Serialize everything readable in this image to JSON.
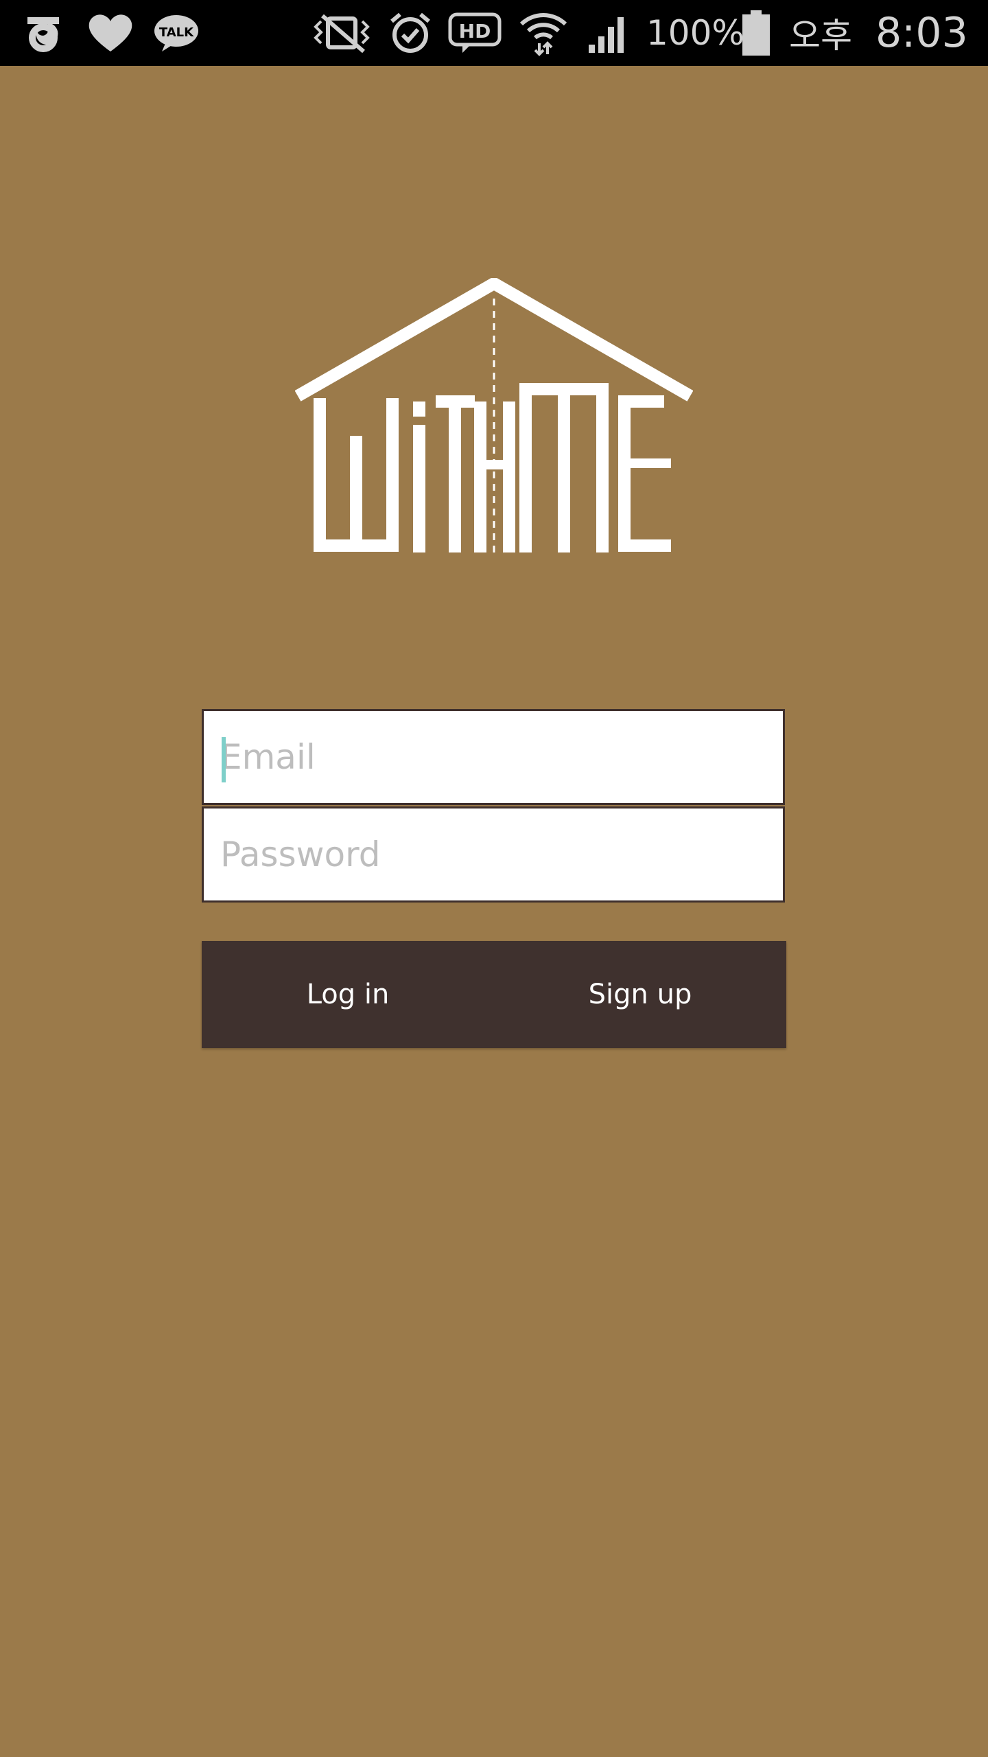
{
  "status_bar": {
    "battery": "100%",
    "ampm": "오후",
    "time": "8:03",
    "talk_label": "TALK",
    "hd_label": "HD",
    "icons": [
      "olleh-icon",
      "heart-icon",
      "kakaotalk-icon",
      "vibrate-mute-icon",
      "alarm-icon",
      "hd-voice-icon",
      "wifi-icon",
      "signal-icon",
      "battery-icon"
    ]
  },
  "logo": {
    "brand": "WiTHME",
    "color": "#ffffff"
  },
  "login_form": {
    "email_placeholder": "Email",
    "email_value": "",
    "password_placeholder": "Password",
    "password_value": "",
    "login_label": "Log in",
    "signup_label": "Sign up"
  },
  "colors": {
    "background": "#9b7a4a",
    "button_bar": "#3f312e",
    "field_border": "#3f2f2c",
    "caret": "#7ecfc9",
    "status_bar": "#000000"
  }
}
